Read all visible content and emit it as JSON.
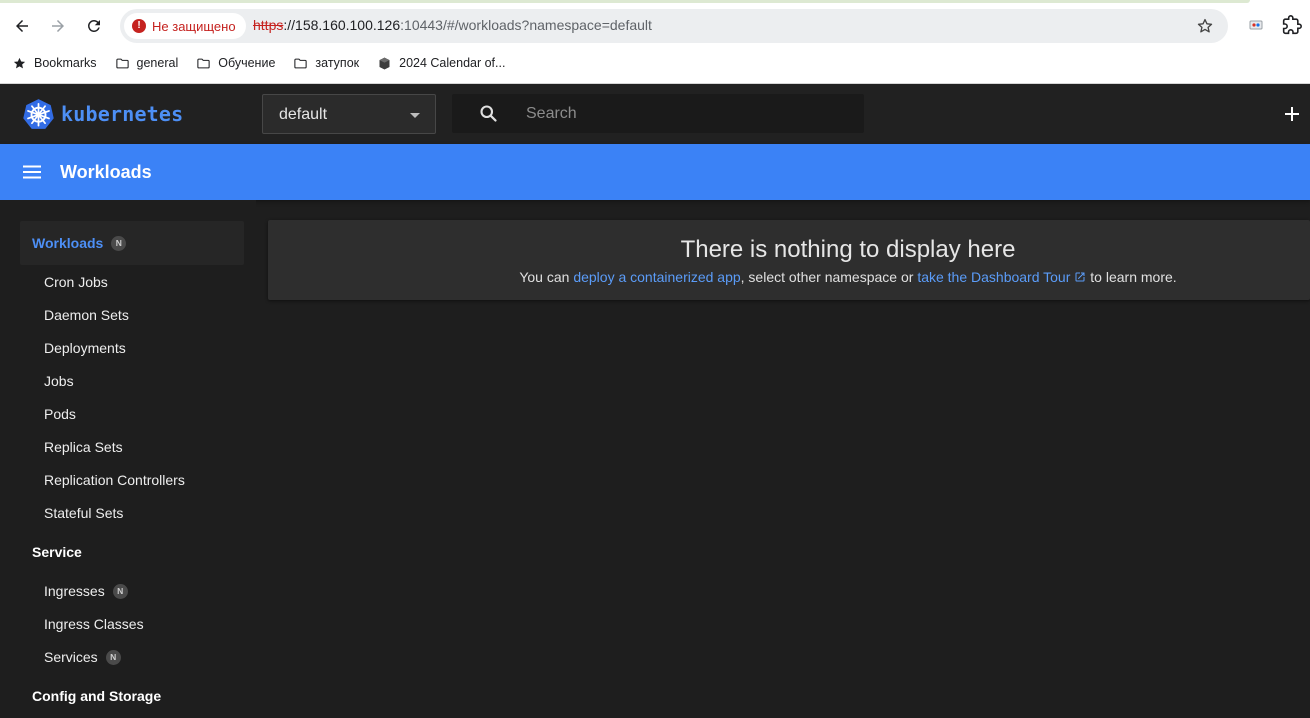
{
  "browser": {
    "security_label": "Не защищено",
    "url_scheme": "https",
    "url_host": "://158.160.100.126",
    "url_rest": ":10443/#/workloads?namespace=default",
    "bookmarks": [
      {
        "label": "Bookmarks",
        "icon": "star-icon"
      },
      {
        "label": "general",
        "icon": "folder-icon"
      },
      {
        "label": "Обучение",
        "icon": "folder-icon"
      },
      {
        "label": "затупок",
        "icon": "folder-icon"
      },
      {
        "label": "2024 Calendar of...",
        "icon": "cube-icon"
      }
    ]
  },
  "app": {
    "brand": "kubernetes",
    "namespace": "default",
    "search_placeholder": "Search",
    "accent_color": "#3b82f6"
  },
  "toolbar": {
    "title": "Workloads"
  },
  "sidebar": {
    "groups": [
      {
        "label": "Workloads",
        "badge": "N",
        "items": [
          "Cron Jobs",
          "Daemon Sets",
          "Deployments",
          "Jobs",
          "Pods",
          "Replica Sets",
          "Replication Controllers",
          "Stateful Sets"
        ]
      },
      {
        "label": "Service",
        "items": [
          {
            "label": "Ingresses",
            "badge": "N"
          },
          {
            "label": "Ingress Classes"
          },
          {
            "label": "Services",
            "badge": "N"
          }
        ]
      },
      {
        "label": "Config and Storage"
      }
    ]
  },
  "main": {
    "empty_title": "There is nothing to display here",
    "empty_prefix": "You can ",
    "deploy_link": "deploy a containerized app",
    "empty_middle": ", select other namespace or ",
    "tour_link": "take the Dashboard Tour",
    "empty_suffix": " to learn more."
  }
}
